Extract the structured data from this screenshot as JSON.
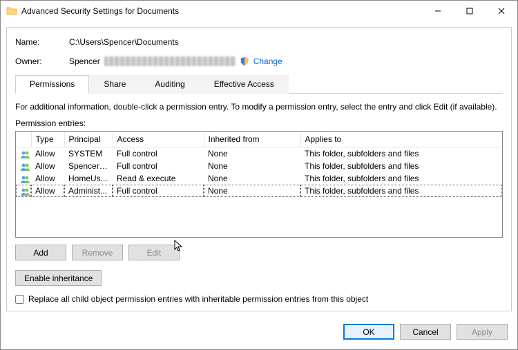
{
  "window": {
    "title": "Advanced Security Settings for Documents"
  },
  "header": {
    "name_label": "Name:",
    "name_value": "C:\\Users\\Spencer\\Documents",
    "owner_label": "Owner:",
    "owner_value": "Spencer",
    "change_label": "Change"
  },
  "tabs": {
    "items": [
      {
        "label": "Permissions"
      },
      {
        "label": "Share"
      },
      {
        "label": "Auditing"
      },
      {
        "label": "Effective Access"
      }
    ],
    "active_index": 0
  },
  "info_text": "For additional information, double-click a permission entry. To modify a permission entry, select the entry and click Edit (if available).",
  "entries_label": "Permission entries:",
  "columns": {
    "type": "Type",
    "principal": "Principal",
    "access": "Access",
    "inherited": "Inherited from",
    "applies": "Applies to"
  },
  "rows": [
    {
      "type": "Allow",
      "principal": "SYSTEM",
      "access": "Full control",
      "inherited": "None",
      "applies": "This folder, subfolders and files",
      "selected": false
    },
    {
      "type": "Allow",
      "principal": "Spencer ...",
      "access": "Full control",
      "inherited": "None",
      "applies": "This folder, subfolders and files",
      "selected": false
    },
    {
      "type": "Allow",
      "principal": "HomeUs...",
      "access": "Read & execute",
      "inherited": "None",
      "applies": "This folder, subfolders and files",
      "selected": false
    },
    {
      "type": "Allow",
      "principal": "Administ...",
      "access": "Full control",
      "inherited": "None",
      "applies": "This folder, subfolders and files",
      "selected": true
    }
  ],
  "buttons": {
    "add": "Add",
    "remove": "Remove",
    "edit": "Edit",
    "enable_inheritance": "Enable inheritance",
    "ok": "OK",
    "cancel": "Cancel",
    "apply": "Apply"
  },
  "checkbox": {
    "label": "Replace all child object permission entries with inheritable permission entries from this object",
    "checked": false
  }
}
